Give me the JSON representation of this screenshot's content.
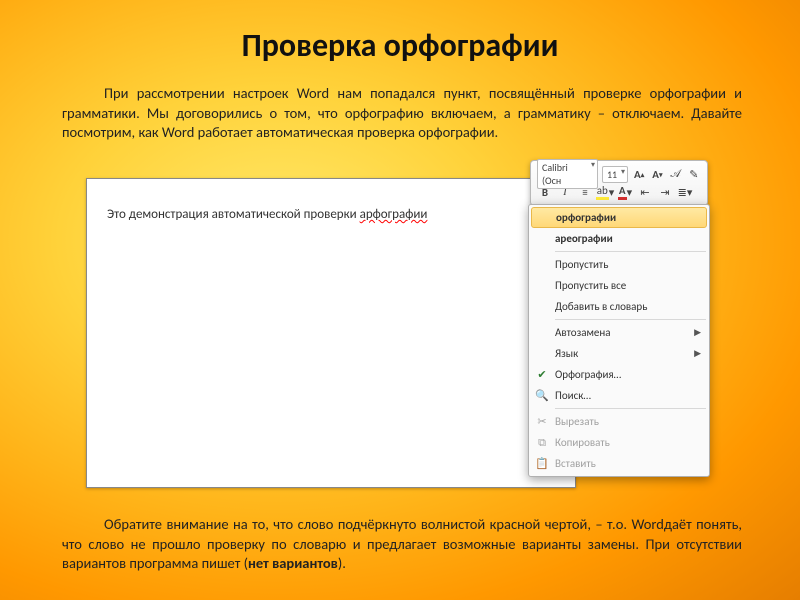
{
  "title": "Проверка орфографии",
  "para1": "При рассмотрении настроек Word нам попадался пункт, посвящённый проверке орфографии и грамматики.  Мы договорились о том, что орфографию включаем, а грамматику – отключаем. Давайте посмотрим, как Word работает автоматическая проверка орфографии.",
  "para2_a": "Обратите внимание на то, что слово подчёркнуто волнистой красной чертой, – т.о. Wordдаёт понять, что слово не прошло проверку по словарю и предлагает возможные варианты замены. При отсутствии вариантов программа пишет (",
  "para2_b": "нет вариантов",
  "para2_c": ").",
  "doc_text_prefix": "Это демонстрация автоматической проверки ",
  "doc_text_error": "арфографии",
  "toolbar": {
    "font_name": "Calibri (Осн",
    "font_size": "11"
  },
  "context_menu": {
    "sugg1": "орфографии",
    "sugg2": "ареографии",
    "skip": "Пропустить",
    "skip_all": "Пропустить все",
    "add": "Добавить в словарь",
    "autocorrect": "Автозамена",
    "language": "Язык",
    "spellcheck": "Орфография…",
    "find": "Поиск…",
    "cut": "Вырезать",
    "copy": "Копировать",
    "paste": "Вставить"
  }
}
